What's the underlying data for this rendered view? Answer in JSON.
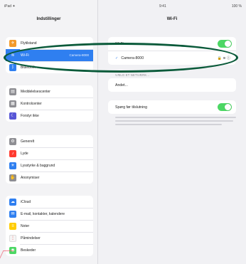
{
  "status": {
    "left": "iPad ✦",
    "time": "9:41",
    "right": "100 %"
  },
  "sidebar": {
    "title": "Indstillinger",
    "group1": [
      {
        "label": "Flytilstand",
        "value": "",
        "icon_color": "#f39a2b",
        "icon": "airplane-icon",
        "glyph": "✈"
      },
      {
        "label": "Wi-Fi",
        "value": "Camera-8000",
        "icon_color": "#2f7ff0",
        "icon": "wifi-icon",
        "glyph": "≋",
        "selected": true
      },
      {
        "label": "Bluetooth",
        "value": "",
        "icon_color": "#2f7ff0",
        "icon": "bluetooth-icon",
        "glyph": "ᛒ"
      }
    ],
    "group2": [
      {
        "label": "Meddelelsescenter",
        "icon_color": "#8e8e93",
        "icon": "notifications-icon",
        "glyph": "▤"
      },
      {
        "label": "Kontrolcenter",
        "icon_color": "#8e8e93",
        "icon": "control-center-icon",
        "glyph": "▦"
      },
      {
        "label": "Forstyr ikke",
        "icon_color": "#5856d6",
        "icon": "moon-icon",
        "glyph": "☾"
      }
    ],
    "group3": [
      {
        "label": "Generelt",
        "icon_color": "#8e8e93",
        "icon": "gear-icon",
        "glyph": "⚙"
      },
      {
        "label": "Lyde",
        "icon_color": "#ff3b30",
        "icon": "speaker-icon",
        "glyph": "♪"
      },
      {
        "label": "Lysstyrke & baggrund",
        "icon_color": "#2f7ff0",
        "icon": "brightness-icon",
        "glyph": "☀"
      },
      {
        "label": "Anonymiser",
        "icon_color": "#8e8e93",
        "icon": "privacy-icon",
        "glyph": "✋"
      }
    ],
    "group4": [
      {
        "label": "iCloud",
        "icon_color": "#2f7ff0",
        "icon": "cloud-icon",
        "glyph": "☁"
      },
      {
        "label": "E-mail, kontakter, kalendere",
        "icon_color": "#2f7ff0",
        "icon": "mail-icon",
        "glyph": "✉"
      },
      {
        "label": "Noter",
        "icon_color": "#ffcc00",
        "icon": "notes-icon",
        "glyph": "≡"
      },
      {
        "label": "Påmindelser",
        "icon_color": "#f5f5f5",
        "icon": "reminders-icon",
        "glyph": "⋮"
      },
      {
        "label": "Beskeder",
        "icon_color": "#4cd764",
        "icon": "messages-icon",
        "glyph": "◉"
      }
    ]
  },
  "main": {
    "title": "Wi-Fi",
    "wifi_label": "Wi-Fi",
    "network_check": "✓",
    "network_name": "Camera-8000",
    "network_icons": "🔒 ≋ ⓘ",
    "section_label": "VÆLG ET NETVÆRK...",
    "other_label": "Andet...",
    "ask_label": "Spørg før tilslutning",
    "wifi_toggle": true,
    "ask_toggle": true
  }
}
